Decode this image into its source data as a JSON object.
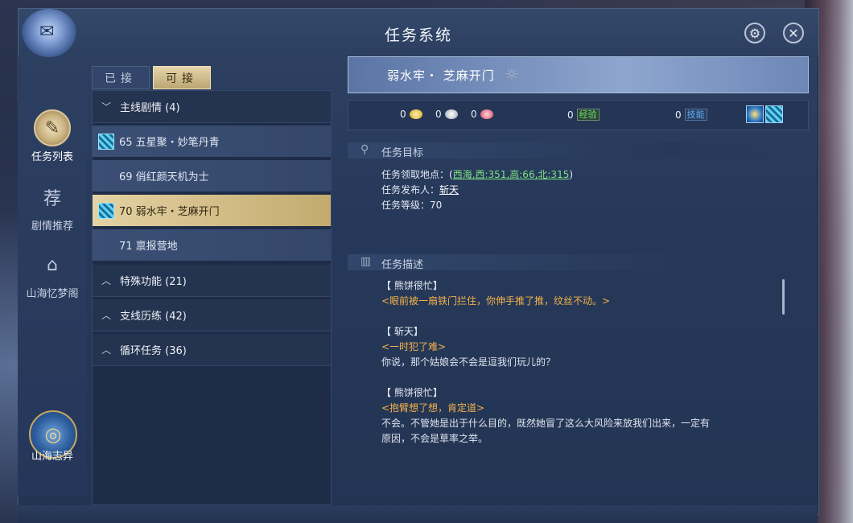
{
  "window": {
    "title": "任务系统"
  },
  "controls": {
    "settings_icon": "gear-icon",
    "close_icon": "close-icon",
    "settings_glyph": "⚙",
    "close_glyph": "✕"
  },
  "nav": {
    "items": [
      {
        "label": "任务列表",
        "icon": "scroll-icon",
        "glyph": "📜",
        "active": true
      },
      {
        "label": "剧情推荐",
        "icon": "book-icon",
        "glyph": "荐",
        "active": false
      },
      {
        "label": "山海忆梦阁",
        "icon": "pavilion-icon",
        "glyph": "⛩",
        "active": false
      }
    ],
    "bottom": {
      "label": "山海志异",
      "icon": "swirl-emblem-icon",
      "glyph": "◎"
    }
  },
  "tabs": {
    "accepted": "已接",
    "available": "可接",
    "active": "available"
  },
  "list": {
    "groups": [
      {
        "label": "主线剧情 (4)",
        "expanded": true
      },
      {
        "label": "特殊功能 (21)",
        "expanded": false
      },
      {
        "label": "支线历练 (42)",
        "expanded": false
      },
      {
        "label": "循环任务 (36)",
        "expanded": false
      }
    ],
    "tasks": [
      {
        "label": "65 五星聚・妙笔丹青",
        "has_icon": true,
        "selected": false
      },
      {
        "label": "69 俏红颜天机为士",
        "has_icon": false,
        "selected": false
      },
      {
        "label": "70 弱水牢・芝麻开门",
        "has_icon": true,
        "selected": true
      },
      {
        "label": "71 禀报营地",
        "has_icon": false,
        "selected": false
      }
    ]
  },
  "quest": {
    "title": "弱水牢・ 芝麻开门",
    "rewards": {
      "gold": "0",
      "silver": "0",
      "copper": "0",
      "exp_value": "0",
      "exp_label": "经验",
      "skill_value": "0",
      "skill_label": "技能"
    },
    "objective_header": "任务目标",
    "location_label": "任务领取地点：(",
    "location_value": "西海,西:351,高:66,北:315",
    "location_close": ")",
    "giver_label": "任务发布人：",
    "giver_value": "斩天",
    "level_line": "任务等级：70",
    "description_header": "任务描述",
    "dialogue": [
      {
        "speaker": "【 熊饼很忙】",
        "lines": [
          {
            "text": "<眼前被一扇铁门拦住，你伸手推了推，纹丝不动。>",
            "color": "orange"
          }
        ]
      },
      {
        "speaker": "【 斩天】",
        "lines": [
          {
            "text": "<一时犯了难>",
            "color": "orange"
          },
          {
            "text": "你说，那个姑娘会不会是逗我们玩儿的？",
            "color": "plain"
          }
        ]
      },
      {
        "speaker": "【 熊饼很忙】",
        "lines": [
          {
            "text": "<抱臂想了想，肯定道>",
            "color": "orange"
          },
          {
            "text": "不会。不管她是出于什么目的，既然她冒了这么大风险来放我们出来，一定有",
            "color": "plain"
          },
          {
            "text": "原因，不会是草率之举。",
            "color": "plain"
          }
        ]
      }
    ]
  },
  "colors": {
    "accent_gold": "#d9c48f",
    "exp_green": "#6ee06e",
    "skill_blue": "#67aef2",
    "dialogue_orange": "#f3b24a"
  }
}
